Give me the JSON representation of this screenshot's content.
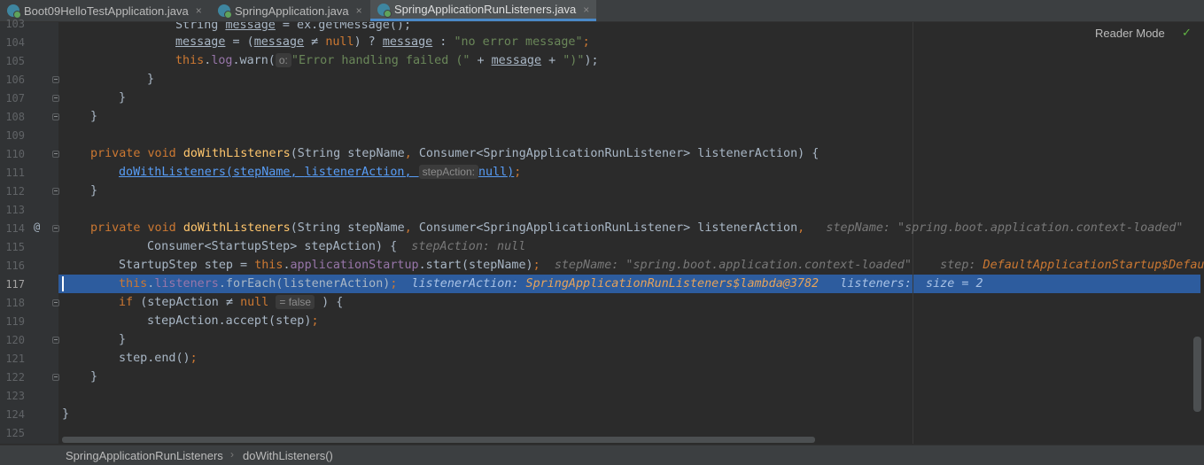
{
  "tabs": [
    {
      "label": "Boot09HelloTestApplication.java",
      "close": "×"
    },
    {
      "label": "SpringApplication.java",
      "close": "×"
    },
    {
      "label": "SpringApplicationRunListeners.java",
      "close": "×"
    }
  ],
  "reader_mode": "Reader Mode",
  "reader_check": "✓",
  "gutter_marker": "@",
  "line_numbers": [
    "103",
    "104",
    "105",
    "106",
    "107",
    "108",
    "109",
    "110",
    "111",
    "112",
    "113",
    "114",
    "115",
    "116",
    "117",
    "118",
    "119",
    "120",
    "121",
    "122",
    "123",
    "124",
    "125"
  ],
  "code": {
    "l103": {
      "a": "String ",
      "b": "message",
      "c": " = ex.getMessage();"
    },
    "l104": {
      "a": "message",
      "b": " = (",
      "c": "message",
      "d": " ≠ ",
      "e": "null",
      "f": ") ? ",
      "g": "message",
      "h": " : ",
      "i": "\"no error message\"",
      "j": ";"
    },
    "l105": {
      "a": "this",
      "b": ".",
      "c": "log",
      "d": ".warn(",
      "hint": "o:",
      "e": "\"Error handling failed (\"",
      "f": " + ",
      "g": "message",
      "h": " + ",
      "i": "\")\"",
      "j": ");"
    },
    "l106": "}",
    "l107": "}",
    "l108": "}",
    "l110": {
      "a": "private ",
      "b": "void ",
      "c": "doWithListeners",
      "d": "(String stepName",
      "e": ", ",
      "f": "Consumer<SpringApplicationRunListener> listenerAction) {"
    },
    "l111": {
      "a": "doWithListeners(stepName",
      "b": ", ",
      "c": "listenerAction",
      "d": ", ",
      "hint": "stepAction:",
      "e": "null",
      "f": ")",
      "g": ";"
    },
    "l112": "}",
    "l114": {
      "a": "private ",
      "b": "void ",
      "c": "doWithListeners",
      "d": "(String stepName",
      "e": ", ",
      "f": "Consumer<SpringApplicationRunListener> listenerAction",
      "g": ",",
      "dbg1": "stepName: \"spring.boot.application.context-loaded\"",
      "dbg2": "s"
    },
    "l115": {
      "a": "Consumer<StartupStep> stepAction) {",
      "dbg": "stepAction: null"
    },
    "l116": {
      "a": "StartupStep step = ",
      "b": "this",
      "c": ".",
      "d": "applicationStartup",
      "e": ".start(stepName)",
      "f": ";",
      "dbg1": "stepName: \"spring.boot.application.context-loaded\"",
      "dbg2": "step: ",
      "dbg2v": "DefaultApplicationStartup$DefaultStartupStep"
    },
    "l117": {
      "a": "this",
      "b": ".",
      "c": "listeners",
      "d": ".forEach(listenerAction)",
      "e": ";",
      "dbg1": "listenerAction: ",
      "dbg1v": "SpringApplicationRunListeners$lambda@3782",
      "dbg2": "listeners:  size = 2"
    },
    "l118": {
      "a": "if ",
      "b": "(stepAction ",
      "c": "≠ ",
      "d": "null",
      "hint": "= false",
      "e": " ) {"
    },
    "l119": {
      "a": "stepAction.accept(step)",
      "b": ";"
    },
    "l120": "}",
    "l121": {
      "a": "step.end()",
      "b": ";"
    },
    "l122": "}",
    "l124": "}"
  },
  "breadcrumb": {
    "class": "SpringApplicationRunListeners",
    "sep": "›",
    "method": "doWithListeners()"
  }
}
